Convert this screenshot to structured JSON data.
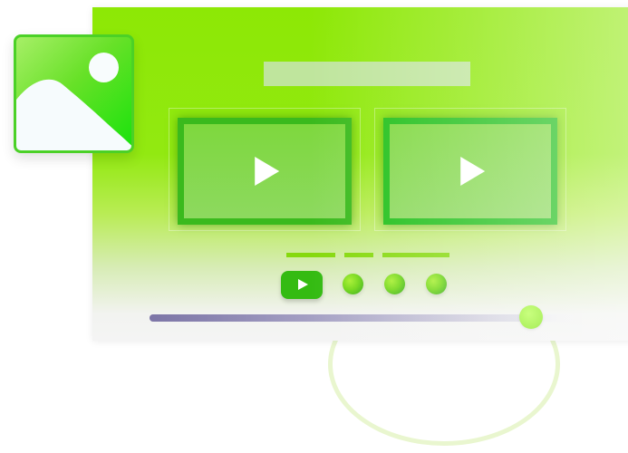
{
  "window": {
    "title": "",
    "videos": [
      {
        "name": "video-1",
        "play_icon": "play-icon"
      },
      {
        "name": "video-2",
        "play_icon": "play-icon"
      }
    ],
    "controls": {
      "youtube_icon": "youtube-play-icon",
      "dots": [
        "dot",
        "dot",
        "dot"
      ]
    },
    "progress": {
      "value": 0.9
    }
  },
  "floating_card": {
    "icon": "image-icon"
  },
  "colors": {
    "brand_green": "#8de805",
    "accent_green": "#34bb12",
    "progress_purple": "#7d76a7"
  }
}
